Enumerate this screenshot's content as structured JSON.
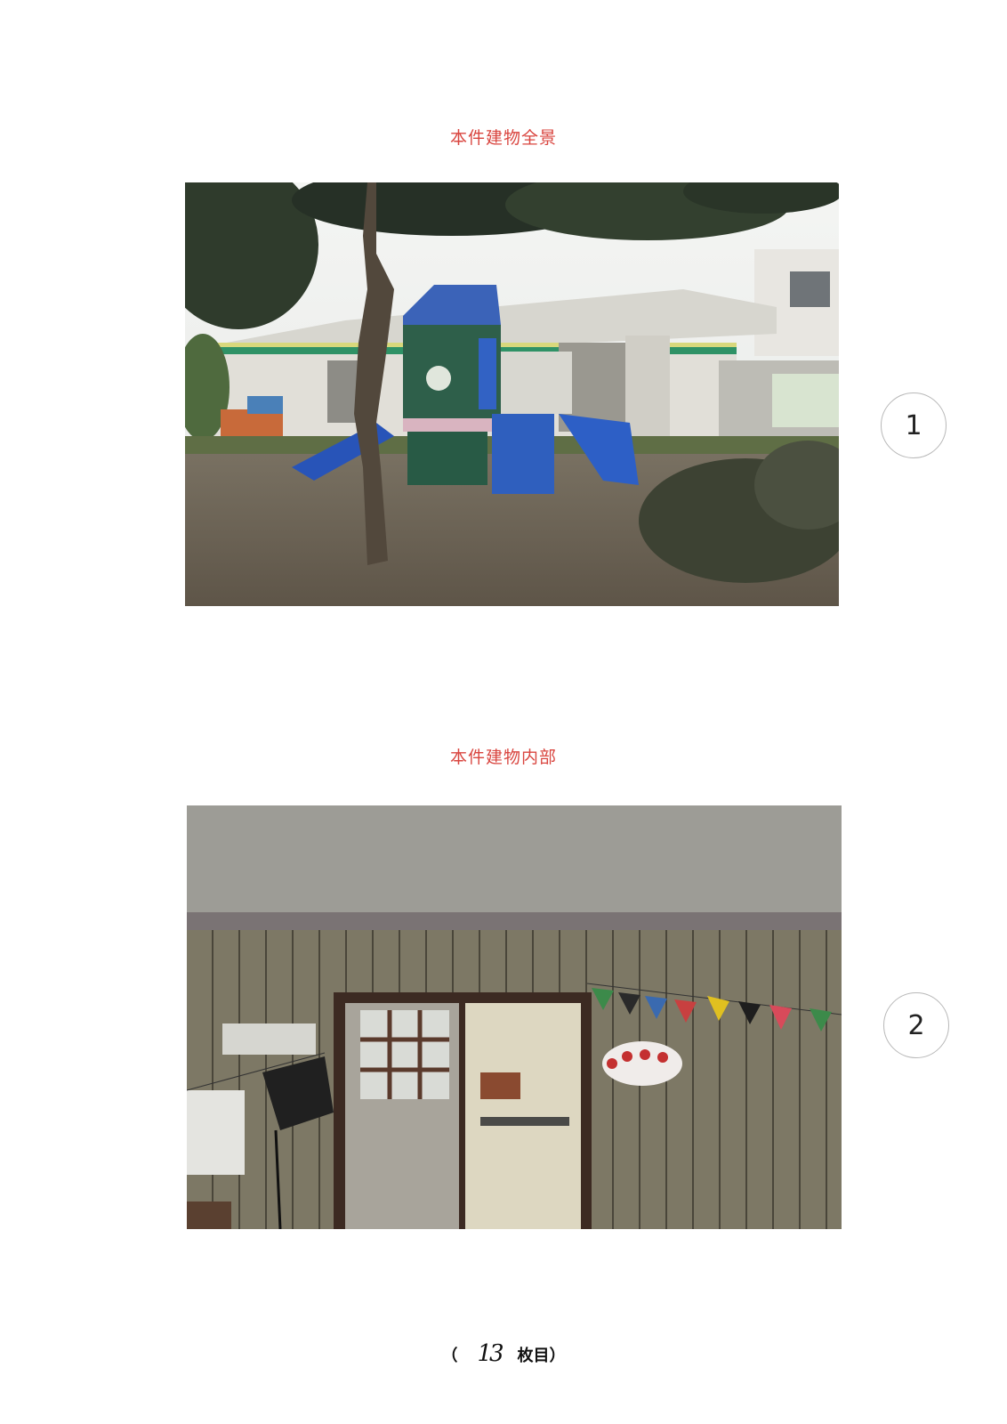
{
  "sections": [
    {
      "caption": "本件建物全景",
      "photo_number": "1",
      "photo_description": "building exterior with playground"
    },
    {
      "caption": "本件建物内部",
      "photo_number": "2",
      "photo_description": "building interior with wood paneling and doorway"
    }
  ],
  "footer": {
    "open_paren": "（",
    "page_number": "13",
    "suffix": "枚目）"
  }
}
